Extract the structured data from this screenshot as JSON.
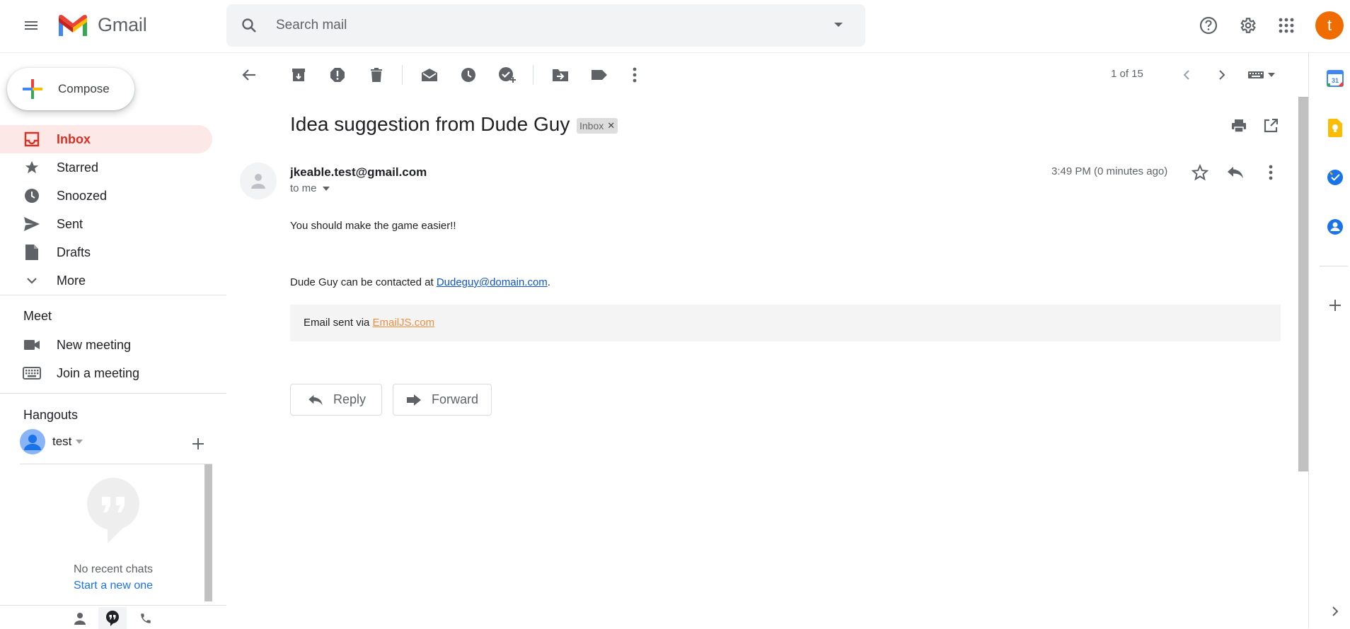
{
  "header": {
    "app_name": "Gmail",
    "search_placeholder": "Search mail",
    "avatar_letter": "t"
  },
  "sidebar": {
    "compose_label": "Compose",
    "items": [
      {
        "label": "Inbox",
        "icon": "inbox-icon",
        "active": true
      },
      {
        "label": "Starred",
        "icon": "star-icon"
      },
      {
        "label": "Snoozed",
        "icon": "clock-icon"
      },
      {
        "label": "Sent",
        "icon": "send-icon"
      },
      {
        "label": "Drafts",
        "icon": "draft-icon"
      },
      {
        "label": "More",
        "icon": "chevron-down-icon"
      }
    ],
    "meet": {
      "title": "Meet",
      "items": [
        {
          "label": "New meeting",
          "icon": "video-icon"
        },
        {
          "label": "Join a meeting",
          "icon": "keyboard-icon"
        }
      ]
    },
    "hangouts": {
      "title": "Hangouts",
      "user_name": "test",
      "no_chats": "No recent chats",
      "start_new": "Start a new one"
    }
  },
  "toolbar": {
    "pager": "1 of 15"
  },
  "message": {
    "subject": "Idea suggestion from Dude Guy",
    "label_chip": "Inbox",
    "sender_email": "jkeable.test@gmail.com",
    "to": "to me",
    "time": "3:49 PM (0 minutes ago)",
    "body_line1": "You should make the game easier!!",
    "body_contact_prefix": "Dude Guy can be contacted at ",
    "body_contact_email": "Dudeguy@domain.com",
    "body_contact_suffix": ".",
    "footer_prefix": "Email sent via ",
    "footer_link": "EmailJS.com",
    "reply_label": "Reply",
    "forward_label": "Forward"
  },
  "colors": {
    "accent_red": "#d93025",
    "active_bg": "#fce8e6",
    "link_blue": "#1155cc",
    "emailjs_orange": "#ef8d3f",
    "avatar_orange": "#ef6c00"
  }
}
